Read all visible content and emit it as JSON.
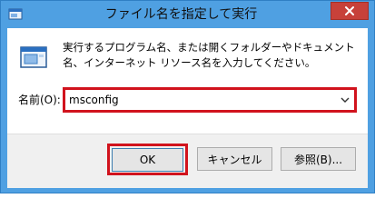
{
  "window": {
    "title": "ファイル名を指定して実行"
  },
  "dialog": {
    "description": "実行するプログラム名、または開くフォルダーやドキュメント名、インターネット リソース名を入力してください。",
    "open_label": "名前(O):",
    "open_value": "msconfig"
  },
  "buttons": {
    "ok": "OK",
    "cancel": "キャンセル",
    "browse": "参照(B)..."
  },
  "colors": {
    "title_bar": "#4fa0e2",
    "close_button": "#c7413a",
    "highlight": "#d1131d"
  },
  "icons": {
    "title": "run-dialog-icon",
    "main": "run-program-icon",
    "close": "close-icon",
    "dropdown": "chevron-down-icon"
  }
}
